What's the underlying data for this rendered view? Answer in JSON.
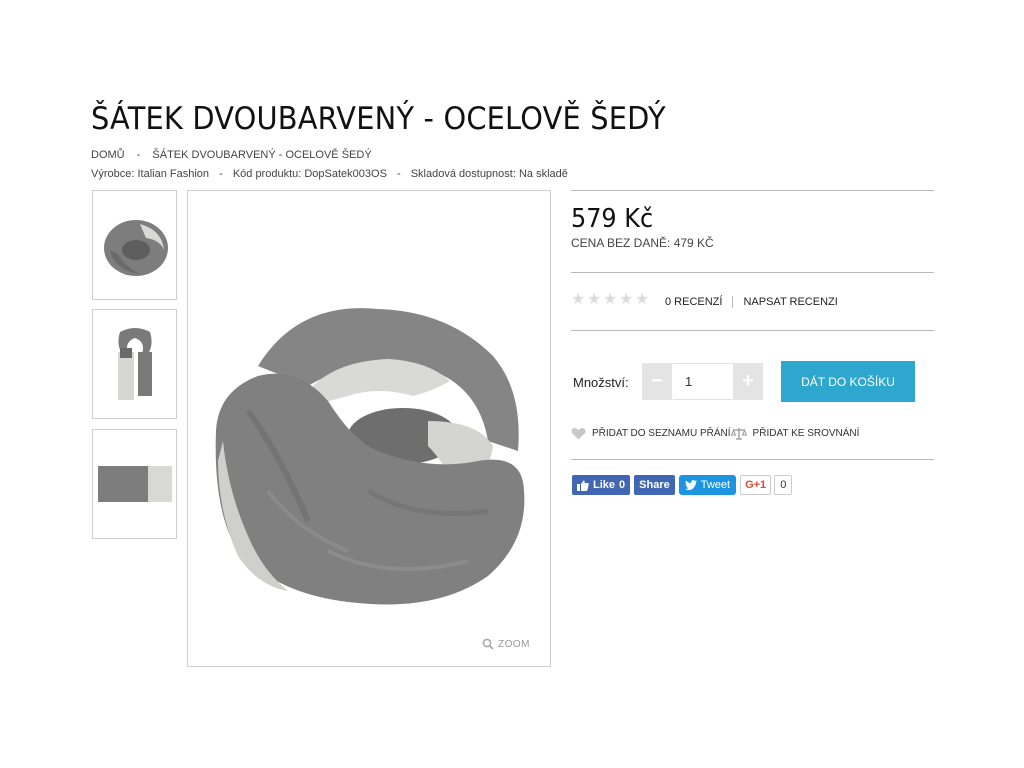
{
  "product": {
    "title": "ŠÁTEK DVOUBARVENÝ - OCELOVĚ ŠEDÝ",
    "price": "579 Kč",
    "price_net": "CENA BEZ DANĚ: 479 KČ"
  },
  "breadcrumb": {
    "home": "DOMŮ",
    "separator": "-",
    "current": "ŠÁTEK DVOUBARVENÝ - OCELOVĚ ŠEDÝ"
  },
  "meta": {
    "manufacturer": "Výrobce: Italian Fashion",
    "code": "Kód produktu: DopSatek003OS",
    "availability": "Skladová dostupnost: Na skladě",
    "separator": "-"
  },
  "gallery": {
    "zoom_label": "ZOOM"
  },
  "reviews": {
    "rating": 0,
    "max": 5,
    "count_label": "0 RECENZÍ",
    "write_label": "NAPSAT RECENZI"
  },
  "purchase": {
    "qty_label": "Množství:",
    "qty_value": "1",
    "minus": "−",
    "plus": "+",
    "cart_label": "DÁT DO KOŠÍKU"
  },
  "actions": {
    "wishlist": "PŘIDAT DO SEZNAMU PŘÁNÍ",
    "compare": "PŘIDAT KE SROVNÁNÍ"
  },
  "social": {
    "like_label": "Like",
    "like_count": "0",
    "share_label": "Share",
    "tweet_label": "Tweet",
    "gplus_label": "G+1",
    "gplus_count": "0"
  },
  "colors": {
    "accent": "#2ea7cf",
    "facebook": "#4267b2",
    "twitter": "#1b95e0",
    "gplus": "#dd4b39",
    "scarf_dark": "#7a7a7a",
    "scarf_light": "#d6d6d2"
  }
}
